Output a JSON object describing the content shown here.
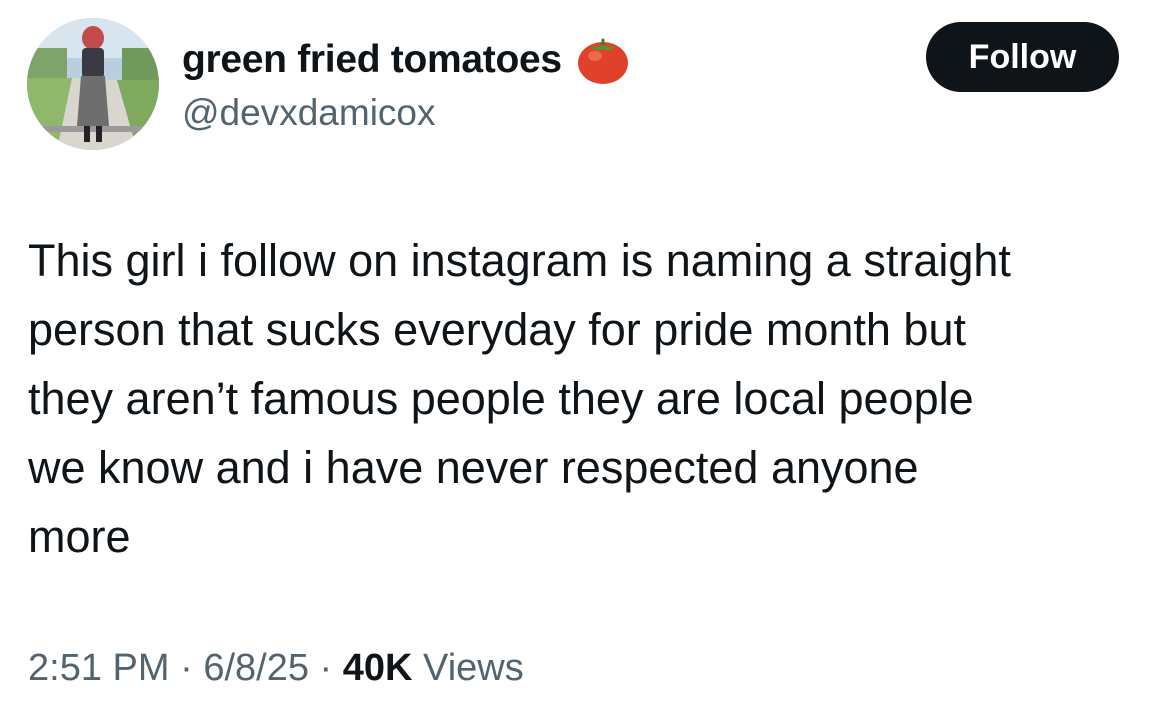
{
  "author": {
    "display_name": "green fried tomatoes",
    "handle": "@devxdamicox",
    "name_emoji_icon": "tomato-icon",
    "avatar_icon": "profile-photo"
  },
  "actions": {
    "follow_label": "Follow"
  },
  "tweet": {
    "lines": [
      "This girl i follow on instagram is naming a straight",
      "person that sucks everyday for pride month but",
      "they aren’t famous people they are local people",
      "we know and i have never respected anyone",
      "more"
    ]
  },
  "meta": {
    "time": "2:51 PM",
    "separator": "·",
    "date": "6/8/25",
    "views_count": "40K",
    "views_label": "Views"
  },
  "colors": {
    "text": "#0f1419",
    "secondary": "#536471",
    "button_bg": "#0f1419",
    "button_text": "#ffffff",
    "background": "#ffffff"
  }
}
